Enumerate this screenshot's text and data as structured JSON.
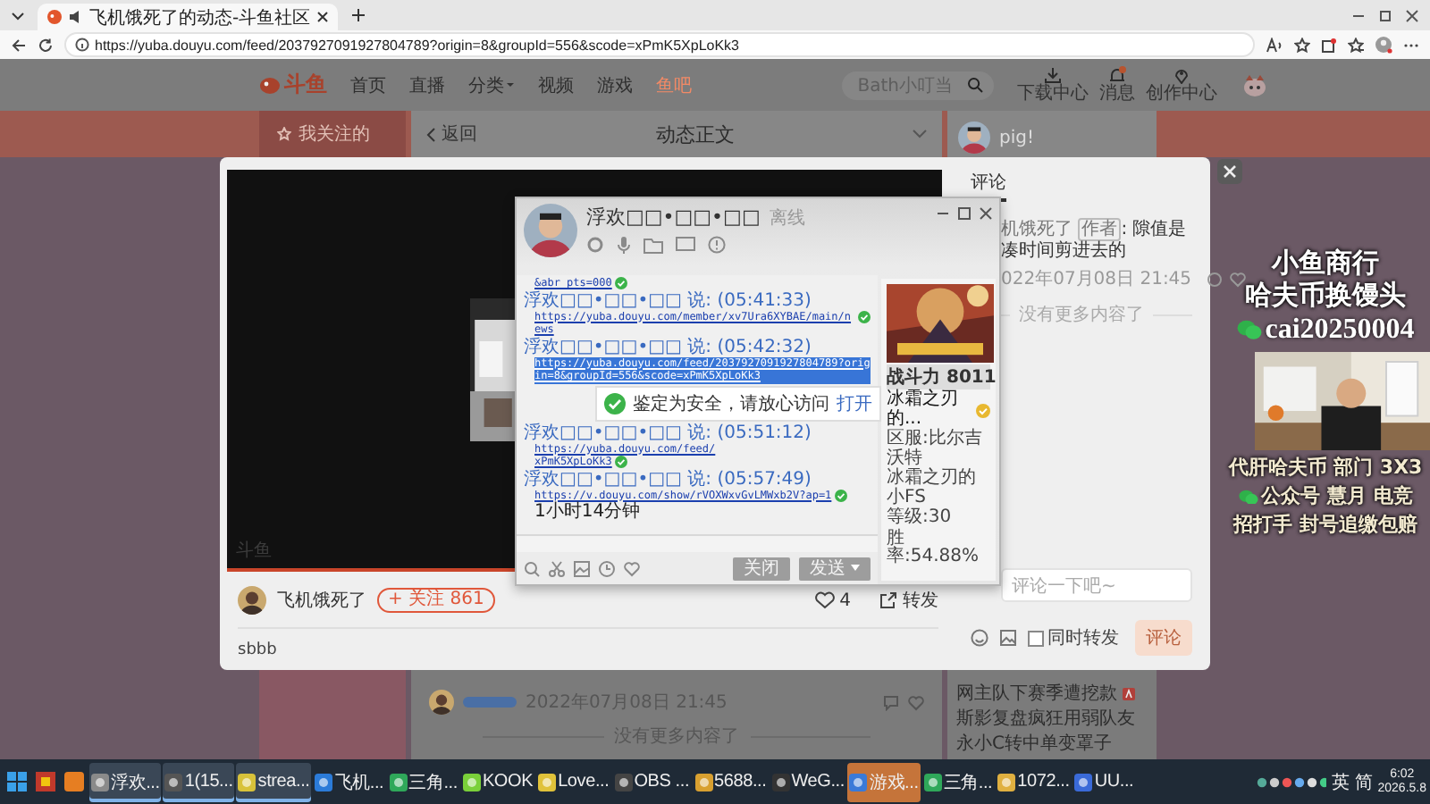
{
  "browser": {
    "tab": {
      "title": "飞机饿死了的动态-斗鱼社区"
    },
    "url": "https://yuba.douyu.com/feed/2037927091927804789?origin=8&groupId=556&scode=xPmK5XpLoKk3"
  },
  "site": {
    "logo": "斗鱼",
    "nav": [
      {
        "label": "首页",
        "selected": false
      },
      {
        "label": "直播",
        "selected": false
      },
      {
        "label": "分类",
        "selected": false
      },
      {
        "label": "视频",
        "selected": false
      },
      {
        "label": "游戏",
        "selected": false
      },
      {
        "label": "鱼吧",
        "selected": true
      }
    ],
    "search": {
      "placeholder": "Bath小叮当"
    },
    "tools": [
      {
        "kind": "download",
        "label": "下载中心"
      },
      {
        "kind": "message",
        "label": "消息"
      },
      {
        "kind": "create",
        "label": "创作中心"
      }
    ],
    "sidebar": {
      "item": "我关注的"
    },
    "feed": {
      "back": "返回",
      "title": "动态正文",
      "comment_time": "2022年07月08日 21:45",
      "end_note": "没有更多内容了"
    },
    "user_card": {
      "name": "pig!"
    },
    "hot_list": [
      "网主队下赛季遭挖款",
      "斯影复盘疯狂用弱队友",
      "永小C转中单变罩子"
    ]
  },
  "post_modal": {
    "video_watermark": "斗鱼",
    "author": "飞机饿死了",
    "follow": "+ 关注 861",
    "likes": "4",
    "share": "转发",
    "body": "sbbb",
    "comments": {
      "tab": "评论",
      "items": [
        {
          "author": "机饿死了",
          "badge": "作者",
          "text": ": 隙值是凑时间剪进去的",
          "time": "022年07月08日 21:45"
        }
      ],
      "end_note": "没有更多内容了"
    },
    "reply": {
      "placeholder": "评论一下吧~",
      "forward": {
        "label": "同时转发",
        "checked": false
      },
      "submit": {
        "label": "评论",
        "disabled": true
      }
    }
  },
  "chat_window": {
    "name": "浮欢□□•□□•□□",
    "status": "离线",
    "messages": [
      {
        "links": [
          "&abr_pts=000"
        ],
        "verified": true,
        "selected": false
      },
      {
        "sender": "浮欢□□•□□•□□ 说: (05:41:33)",
        "links": [
          "https://yuba.douyu.com/member/xv7Ura6XYBAE/main/news"
        ],
        "verified": true,
        "selected": false
      },
      {
        "sender": "浮欢□□•□□•□□ 说: (05:42:32)",
        "links": [
          "https://yuba.douyu.com/feed/2037927091927804789?origin=8&groupId=556&scode=xPmK5XpLoKk3"
        ],
        "verified": false,
        "selected": true
      },
      {
        "sender": "浮欢□□•□□•□□ 说: (05:51:12)",
        "links": [
          "https://yuba.douyu.com/feed/",
          "xPmK5XpLoKk3"
        ],
        "verified": true,
        "selected": false
      },
      {
        "sender": "浮欢□□•□□•□□ 说: (05:57:49)",
        "links": [
          "https://v.douyu.com/show/rVOXWxvGvLMWxb2V?ap=1"
        ],
        "note": "1小时14分钟",
        "verified": true,
        "selected": false
      }
    ],
    "toast": {
      "text": "鉴定为安全，请放心访问",
      "link": "打开"
    },
    "buttons": [
      {
        "label": "关闭",
        "dropdown": false
      },
      {
        "label": "发送",
        "dropdown": true
      }
    ],
    "profile": {
      "banner": "战斗力 8011",
      "name": "冰霜之刃的...",
      "lines": [
        "区服:比尔吉沃特",
        "冰霜之刃的小FS",
        "等级:30",
        "胜率:54.88%"
      ]
    }
  },
  "stream_overlay": {
    "headline": [
      "小鱼商行",
      "哈夫币换馒头"
    ],
    "wechat": "cai20250004",
    "ads": [
      {
        "text": "代肝哈夫币 部门 3X3",
        "icon": false
      },
      {
        "text": "公众号 慧月 电竞",
        "icon": true
      },
      {
        "text": "招打手 封号追缴包赔",
        "icon": false
      }
    ]
  },
  "taskbar": {
    "items": [
      {
        "label": "浮欢...",
        "selected": true,
        "flashing": false
      },
      {
        "label": "1(15...",
        "selected": true,
        "flashing": false
      },
      {
        "label": "strea...",
        "selected": true,
        "flashing": false
      },
      {
        "label": "飞机...",
        "selected": false,
        "flashing": false
      },
      {
        "label": "三角...",
        "selected": false,
        "flashing": false
      },
      {
        "label": "KOOK",
        "selected": false,
        "flashing": false
      },
      {
        "label": "Love...",
        "selected": false,
        "flashing": false
      },
      {
        "label": "OBS ...",
        "selected": false,
        "flashing": false
      },
      {
        "label": "5688...",
        "selected": false,
        "flashing": false
      },
      {
        "label": "WeG...",
        "selected": false,
        "flashing": false
      },
      {
        "label": "游戏...",
        "selected": false,
        "flashing": true
      },
      {
        "label": "三角...",
        "selected": false,
        "flashing": false
      },
      {
        "label": "1072...",
        "selected": false,
        "flashing": false
      },
      {
        "label": "UU...",
        "selected": false,
        "flashing": false
      }
    ],
    "ime": [
      "英",
      "简"
    ],
    "time": "6:02",
    "date": "2026.5.8"
  }
}
